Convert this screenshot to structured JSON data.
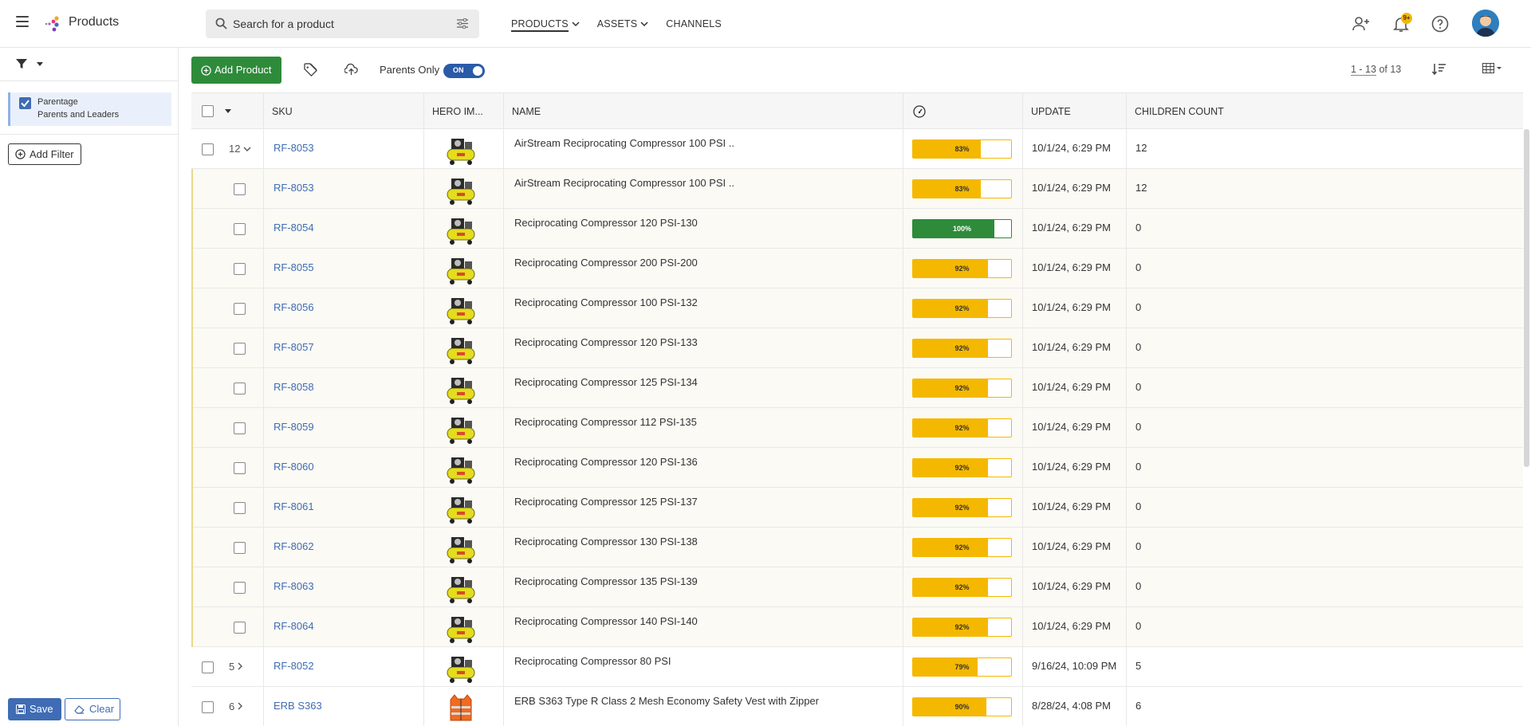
{
  "app": {
    "title": "Products"
  },
  "search": {
    "placeholder": "Search for a product"
  },
  "nav": {
    "products": "PRODUCTS",
    "assets": "ASSETS",
    "channels": "CHANNELS"
  },
  "notifications": {
    "badge": "9+"
  },
  "sidebar": {
    "filter_chip": {
      "title": "Parentage",
      "value": "Parents and Leaders",
      "checked": true
    },
    "add_filter": "Add Filter",
    "save": "Save",
    "clear": "Clear"
  },
  "toolbar": {
    "add_product": "Add Product",
    "parents_only_label": "Parents Only",
    "parents_only_state": "ON",
    "pager_range": "1 - 13",
    "pager_total": "of 13"
  },
  "table": {
    "headers": {
      "sku": "SKU",
      "hero": "HERO IM...",
      "name": "NAME",
      "update": "UPDATE",
      "children": "CHILDREN COUNT"
    },
    "rows": [
      {
        "kind": "parent",
        "count": "12",
        "expanded": true,
        "sku": "RF-8053",
        "name": "AirStream Reciprocating Compressor 100 PSI ..",
        "completeness": 83,
        "completeness_label": "83%",
        "update": "10/1/24, 6:29 PM",
        "children": "12",
        "image": "compressor"
      },
      {
        "kind": "child",
        "sku": "RF-8053",
        "name": "AirStream Reciprocating Compressor 100 PSI ..",
        "completeness": 83,
        "completeness_label": "83%",
        "update": "10/1/24, 6:29 PM",
        "children": "12",
        "image": "compressor"
      },
      {
        "kind": "child",
        "sku": "RF-8054",
        "name": "Reciprocating Compressor 120 PSI-130",
        "completeness": 100,
        "completeness_label": "100%",
        "update": "10/1/24, 6:29 PM",
        "children": "0",
        "image": "compressor"
      },
      {
        "kind": "child",
        "sku": "RF-8055",
        "name": "Reciprocating Compressor 200 PSI-200",
        "completeness": 92,
        "completeness_label": "92%",
        "update": "10/1/24, 6:29 PM",
        "children": "0",
        "image": "compressor"
      },
      {
        "kind": "child",
        "sku": "RF-8056",
        "name": "Reciprocating Compressor 100 PSI-132",
        "completeness": 92,
        "completeness_label": "92%",
        "update": "10/1/24, 6:29 PM",
        "children": "0",
        "image": "compressor"
      },
      {
        "kind": "child",
        "sku": "RF-8057",
        "name": "Reciprocating Compressor 120 PSI-133",
        "completeness": 92,
        "completeness_label": "92%",
        "update": "10/1/24, 6:29 PM",
        "children": "0",
        "image": "compressor"
      },
      {
        "kind": "child",
        "sku": "RF-8058",
        "name": "Reciprocating Compressor 125 PSI-134",
        "completeness": 92,
        "completeness_label": "92%",
        "update": "10/1/24, 6:29 PM",
        "children": "0",
        "image": "compressor"
      },
      {
        "kind": "child",
        "sku": "RF-8059",
        "name": "Reciprocating Compressor 112 PSI-135",
        "completeness": 92,
        "completeness_label": "92%",
        "update": "10/1/24, 6:29 PM",
        "children": "0",
        "image": "compressor"
      },
      {
        "kind": "child",
        "sku": "RF-8060",
        "name": "Reciprocating Compressor 120 PSI-136",
        "completeness": 92,
        "completeness_label": "92%",
        "update": "10/1/24, 6:29 PM",
        "children": "0",
        "image": "compressor"
      },
      {
        "kind": "child",
        "sku": "RF-8061",
        "name": "Reciprocating Compressor 125 PSI-137",
        "completeness": 92,
        "completeness_label": "92%",
        "update": "10/1/24, 6:29 PM",
        "children": "0",
        "image": "compressor"
      },
      {
        "kind": "child",
        "sku": "RF-8062",
        "name": "Reciprocating Compressor 130 PSI-138",
        "completeness": 92,
        "completeness_label": "92%",
        "update": "10/1/24, 6:29 PM",
        "children": "0",
        "image": "compressor"
      },
      {
        "kind": "child",
        "sku": "RF-8063",
        "name": "Reciprocating Compressor 135 PSI-139",
        "completeness": 92,
        "completeness_label": "92%",
        "update": "10/1/24, 6:29 PM",
        "children": "0",
        "image": "compressor"
      },
      {
        "kind": "child",
        "sku": "RF-8064",
        "name": "Reciprocating Compressor 140 PSI-140",
        "completeness": 92,
        "completeness_label": "92%",
        "update": "10/1/24, 6:29 PM",
        "children": "0",
        "image": "compressor"
      },
      {
        "kind": "parent",
        "count": "5",
        "expanded": false,
        "sku": "RF-8052",
        "name": "Reciprocating Compressor 80 PSI",
        "completeness": 79,
        "completeness_label": "79%",
        "update": "9/16/24, 10:09 PM",
        "children": "5",
        "image": "compressor"
      },
      {
        "kind": "parent",
        "count": "6",
        "expanded": false,
        "sku": "ERB S363",
        "name": "ERB S363 Type R Class 2 Mesh Economy Safety Vest with Zipper",
        "completeness": 90,
        "completeness_label": "90%",
        "update": "8/28/24, 4:08 PM",
        "children": "6",
        "image": "vest"
      }
    ]
  },
  "colors": {
    "accent_blue": "#3f6cb4",
    "green": "#2e8b3a",
    "yellow": "#f5b800"
  }
}
